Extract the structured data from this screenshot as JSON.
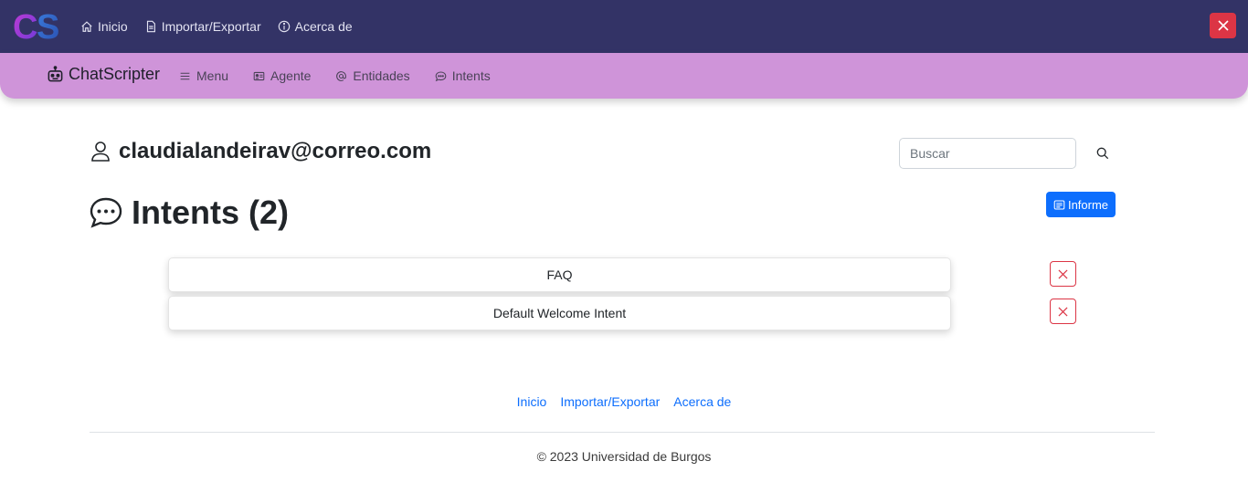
{
  "topbar": {
    "logo_text": "CS",
    "nav": [
      {
        "label": "Inicio",
        "icon": "home-icon"
      },
      {
        "label": "Importar/Exportar",
        "icon": "file-icon"
      },
      {
        "label": "Acerca de",
        "icon": "info-icon"
      }
    ],
    "close_icon": "close-icon",
    "bg_color": "#333366",
    "close_color": "#dc3545"
  },
  "subbar": {
    "brand": "ChatScripter",
    "brand_icon": "robot-icon",
    "nav": [
      {
        "label": "Menu",
        "icon": "list-icon"
      },
      {
        "label": "Agente",
        "icon": "id-card-icon"
      },
      {
        "label": "Entidades",
        "icon": "at-icon"
      },
      {
        "label": "Intents",
        "icon": "chat-icon"
      }
    ],
    "bg_color": "#cf94d9"
  },
  "user": {
    "icon": "person-icon",
    "email": "claudialandeirav@correo.com"
  },
  "search": {
    "placeholder": "Buscar",
    "value": "",
    "icon": "search-icon"
  },
  "heading": {
    "icon": "chat-dots-icon",
    "text": "Intents (2)"
  },
  "report_button": {
    "label": "Informe",
    "icon": "report-icon",
    "color": "#0d6efd"
  },
  "intents": [
    {
      "name": "FAQ"
    },
    {
      "name": "Default Welcome Intent"
    }
  ],
  "footer": {
    "links": [
      "Inicio",
      "Importar/Exportar",
      "Acerca de"
    ],
    "copyright": "© 2023 Universidad de Burgos"
  }
}
